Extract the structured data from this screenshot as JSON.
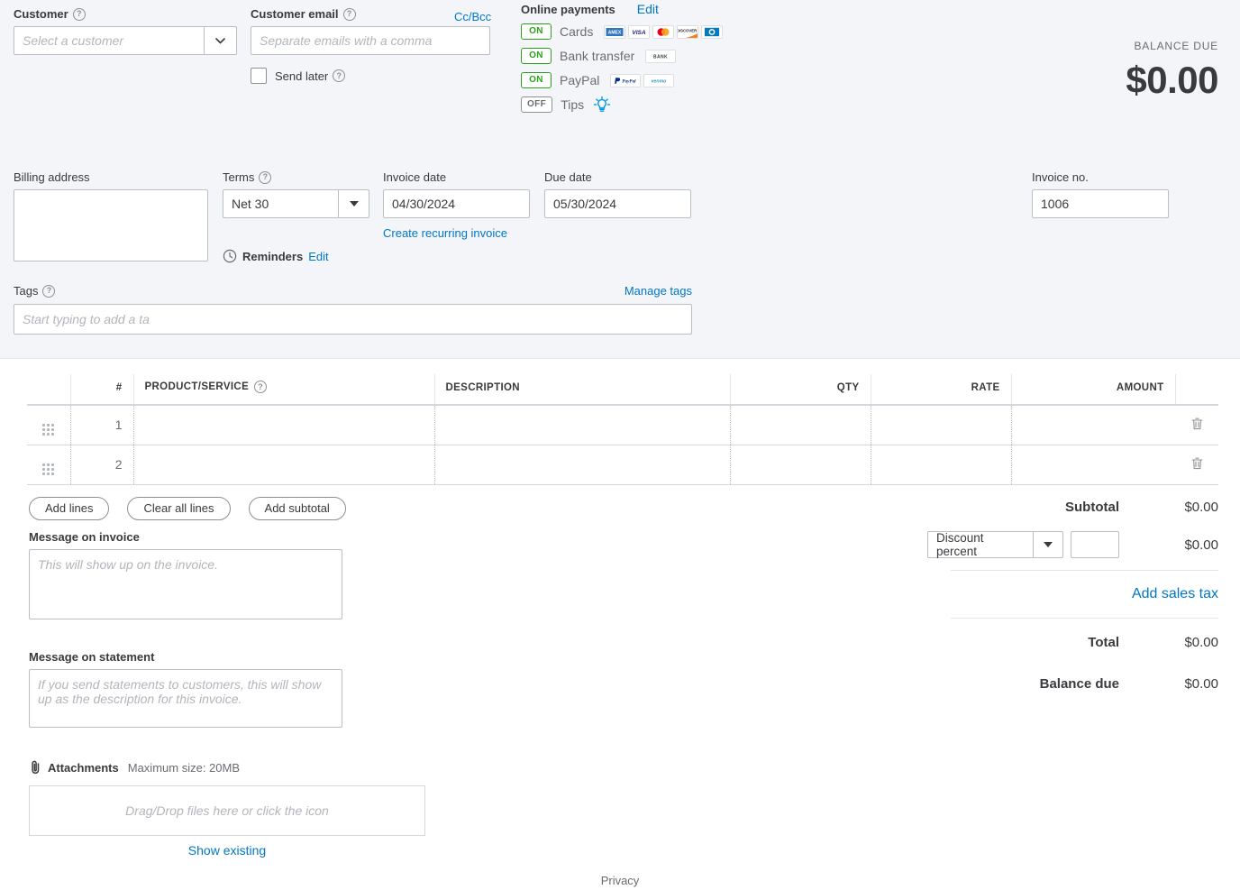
{
  "colors": {
    "panel_bg": "#f4f5f8",
    "link": "#0077c5",
    "toggle_on": "#2ca01c",
    "toggle_off": "#8d9096",
    "text": "#393a3d",
    "muted": "#6b6c72",
    "border": "#babec5"
  },
  "customer": {
    "label": "Customer",
    "help_icon": "help-circle-icon",
    "placeholder": "Select a customer",
    "value": "",
    "dropdown_icon": "chevron-down-icon"
  },
  "customer_email": {
    "label": "Customer email",
    "help_icon": "help-circle-icon",
    "placeholder": "Separate emails with a comma",
    "value": "",
    "ccbcc_label": "Cc/Bcc",
    "send_later_label": "Send later",
    "send_later_checked": false,
    "send_later_help_icon": "help-circle-icon"
  },
  "online_payments": {
    "title": "Online payments",
    "edit_label": "Edit",
    "rows": [
      {
        "state": "ON",
        "name": "Cards",
        "badges": [
          "amex-card-icon",
          "visa-card-icon",
          "mastercard-card-icon",
          "discover-card-icon",
          "dinersclub-card-icon"
        ]
      },
      {
        "state": "ON",
        "name": "Bank transfer",
        "badges": [
          "bank-icon"
        ]
      },
      {
        "state": "ON",
        "name": "PayPal",
        "badges": [
          "paypal-icon",
          "venmo-icon"
        ]
      },
      {
        "state": "OFF",
        "name": "Tips",
        "badges": [
          "lightbulb-icon"
        ]
      }
    ]
  },
  "balance_due": {
    "label": "BALANCE DUE",
    "amount": "$0.00"
  },
  "billing_address": {
    "label": "Billing address",
    "value": ""
  },
  "terms": {
    "label": "Terms",
    "help_icon": "help-circle-icon",
    "value": "Net 30",
    "dropdown_icon": "caret-down-icon"
  },
  "invoice_date": {
    "label": "Invoice date",
    "value": "04/30/2024"
  },
  "due_date": {
    "label": "Due date",
    "value": "05/30/2024"
  },
  "recurring_link": "Create recurring invoice",
  "reminders": {
    "icon": "clock-icon",
    "label": "Reminders",
    "edit_label": "Edit"
  },
  "invoice_no": {
    "label": "Invoice no.",
    "value": "1006"
  },
  "tags": {
    "label": "Tags",
    "help_icon": "help-circle-icon",
    "manage_label": "Manage tags",
    "placeholder": "Start typing to add a ta",
    "value": ""
  },
  "line_table": {
    "columns": [
      {
        "key": "handle",
        "label": ""
      },
      {
        "key": "num",
        "label": "#"
      },
      {
        "key": "product",
        "label": "PRODUCT/SERVICE",
        "help_icon": "help-circle-icon"
      },
      {
        "key": "description",
        "label": "DESCRIPTION"
      },
      {
        "key": "qty",
        "label": "QTY"
      },
      {
        "key": "rate",
        "label": "RATE"
      },
      {
        "key": "amount",
        "label": "AMOUNT"
      },
      {
        "key": "delete",
        "label": ""
      }
    ],
    "rows": [
      {
        "num": "1",
        "product": "",
        "description": "",
        "qty": "",
        "rate": "",
        "amount": "",
        "handle_icon": "drag-handle-icon",
        "delete_icon": "trash-icon"
      },
      {
        "num": "2",
        "product": "",
        "description": "",
        "qty": "",
        "rate": "",
        "amount": "",
        "handle_icon": "drag-handle-icon",
        "delete_icon": "trash-icon"
      }
    ]
  },
  "line_buttons": {
    "add_lines": "Add lines",
    "clear_all_lines": "Clear all lines",
    "add_subtotal": "Add subtotal"
  },
  "message_invoice": {
    "label": "Message on invoice",
    "placeholder": "This will show up on the invoice.",
    "value": ""
  },
  "message_statement": {
    "label": "Message on statement",
    "placeholder": "If you send statements to customers, this will show up as the description for this invoice.",
    "value": ""
  },
  "attachments": {
    "icon": "paperclip-icon",
    "title": "Attachments",
    "max_size": "Maximum size: 20MB",
    "dropzone_text": "Drag/Drop files here or click the icon",
    "show_existing": "Show existing"
  },
  "totals": {
    "subtotal_label": "Subtotal",
    "subtotal_value": "$0.00",
    "discount_type": "Discount percent",
    "discount_dropdown_icon": "caret-down-icon",
    "discount_input_value": "",
    "discount_value": "$0.00",
    "add_sales_tax": "Add sales tax",
    "total_label": "Total",
    "total_value": "$0.00",
    "balance_due_label": "Balance due",
    "balance_due_value": "$0.00"
  },
  "footer": {
    "privacy": "Privacy"
  }
}
